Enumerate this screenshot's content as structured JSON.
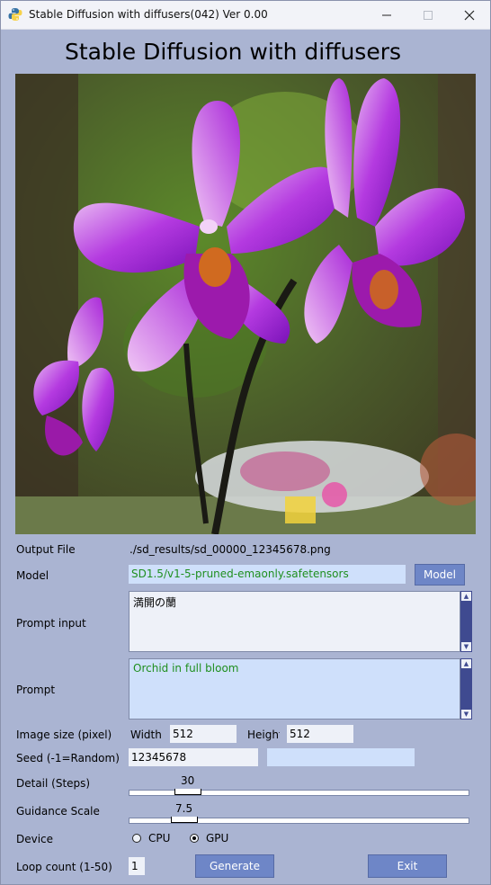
{
  "window": {
    "title": "Stable Diffusion with diffusers(042)  Ver 0.00",
    "minimize_icon": "minimize-icon",
    "maximize_icon": "maximize-icon",
    "close_icon": "close-icon"
  },
  "heading": "Stable Diffusion with diffusers",
  "image": {
    "description_icon": "generated-orchid-image"
  },
  "output_file": {
    "label": "Output File",
    "value": "./sd_results/sd_00000_12345678.png"
  },
  "model": {
    "label": "Model",
    "value": "SD1.5/v1-5-pruned-emaonly.safetensors",
    "button": "Model"
  },
  "prompt_input": {
    "label": "Prompt input",
    "value": "満開の蘭"
  },
  "prompt": {
    "label": "Prompt",
    "value": "Orchid in full bloom"
  },
  "image_size": {
    "label": "Image size (pixel)",
    "width_label": "Width",
    "width": "512",
    "height_label": "Height",
    "height": "512"
  },
  "seed": {
    "label": "Seed  (-1=Random)",
    "value": "12345678",
    "extra": ""
  },
  "steps": {
    "label": "Detail (Steps)",
    "value": "30",
    "min": 1,
    "max": 150
  },
  "guidance": {
    "label": "Guidance Scale",
    "value": "7.5",
    "min": 1,
    "max": 30
  },
  "device": {
    "label": "Device",
    "options": [
      "CPU",
      "GPU"
    ],
    "selected": "GPU"
  },
  "loop": {
    "label": "Loop count (1-50)",
    "value": "1"
  },
  "buttons": {
    "generate": "Generate",
    "exit": "Exit"
  },
  "colors": {
    "accent": "#6e86c7",
    "background": "#aab4d2",
    "prompt_text": "#1f8f1f",
    "scrollbar": "#3f4a90"
  }
}
